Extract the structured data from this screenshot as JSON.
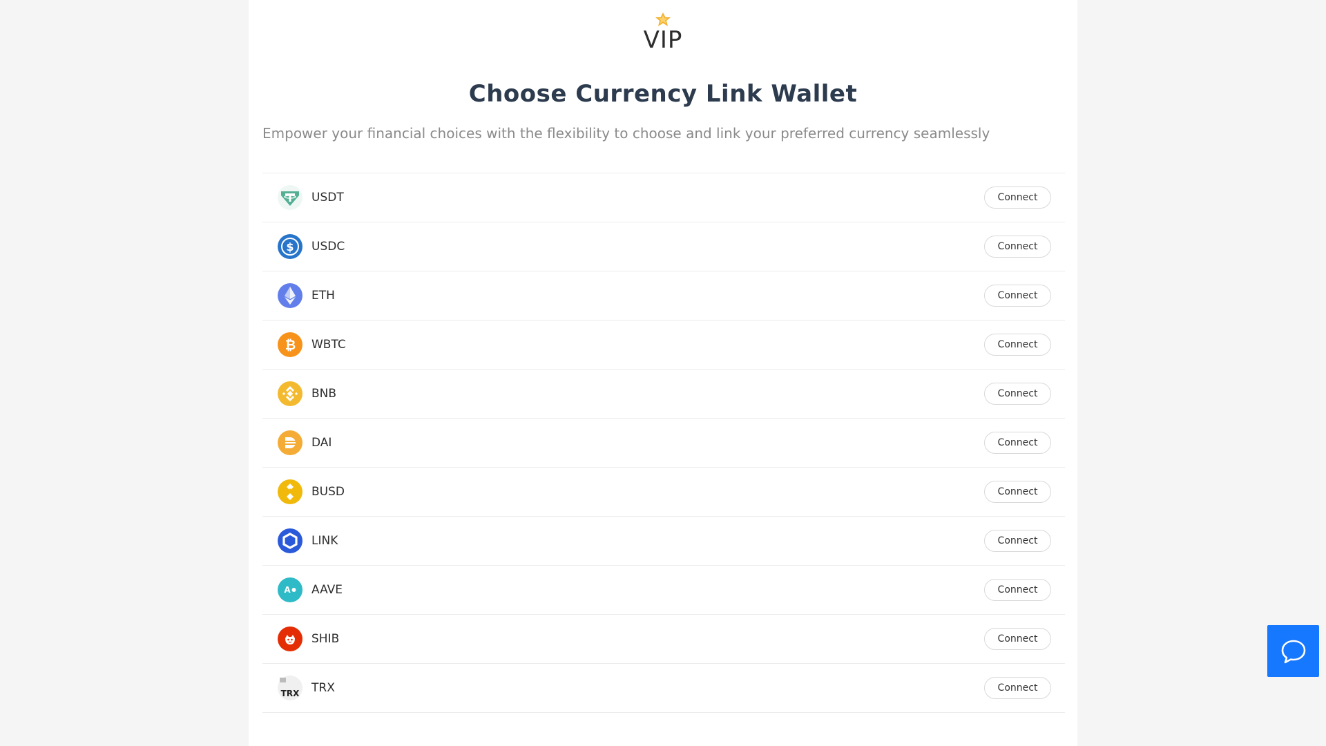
{
  "header": {
    "logo_text": "VIP",
    "title": "Choose Currency Link Wallet",
    "subtitle": "Empower your financial choices with the flexibility to choose and link your preferred currency seamlessly"
  },
  "currencies": [
    {
      "symbol": "USDT",
      "icon": "usdt-icon",
      "color": "#53ae94",
      "button": "Connect"
    },
    {
      "symbol": "USDC",
      "icon": "usdc-icon",
      "color": "#2775ca",
      "button": "Connect"
    },
    {
      "symbol": "ETH",
      "icon": "eth-icon",
      "color": "#627eea",
      "button": "Connect"
    },
    {
      "symbol": "WBTC",
      "icon": "wbtc-icon",
      "color": "#f7931a",
      "button": "Connect"
    },
    {
      "symbol": "BNB",
      "icon": "bnb-icon",
      "color": "#f3ba2f",
      "button": "Connect"
    },
    {
      "symbol": "DAI",
      "icon": "dai-icon",
      "color": "#f5ac37",
      "button": "Connect"
    },
    {
      "symbol": "BUSD",
      "icon": "busd-icon",
      "color": "#f0b90b",
      "button": "Connect"
    },
    {
      "symbol": "LINK",
      "icon": "link-icon",
      "color": "#2a5ada",
      "button": "Connect"
    },
    {
      "symbol": "AAVE",
      "icon": "aave-icon",
      "color": "#2ebac6",
      "button": "Connect"
    },
    {
      "symbol": "SHIB",
      "icon": "shib-icon",
      "color": "#e42d04",
      "button": "Connect"
    },
    {
      "symbol": "TRX",
      "icon": "trx-icon",
      "color": "#ffffff",
      "button": "Connect"
    }
  ],
  "chat": {
    "icon": "chat-bubble-icon",
    "color": "#1677ff"
  }
}
